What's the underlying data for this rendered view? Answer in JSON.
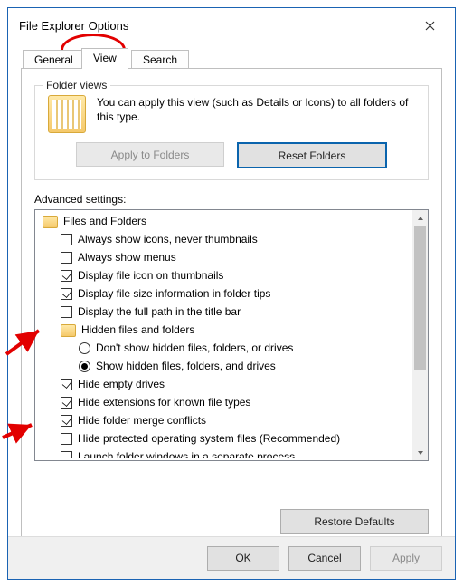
{
  "window": {
    "title": "File Explorer Options"
  },
  "tabs": {
    "general": "General",
    "view": "View",
    "search": "Search"
  },
  "folderViews": {
    "legend": "Folder views",
    "text": "You can apply this view (such as Details or Icons) to all folders of this type.",
    "applyBtn": "Apply to Folders",
    "resetBtn": "Reset Folders"
  },
  "advanced": {
    "label": "Advanced settings:",
    "root": "Files and Folders",
    "items": {
      "alwaysIcons": "Always show icons, never thumbnails",
      "alwaysMenus": "Always show menus",
      "fileIconThumb": "Display file icon on thumbnails",
      "fileSizeTips": "Display file size information in folder tips",
      "fullPathTitle": "Display the full path in the title bar",
      "hiddenGroup": "Hidden files and folders",
      "dontShowHidden": "Don't show hidden files, folders, or drives",
      "showHidden": "Show hidden files, folders, and drives",
      "hideEmpty": "Hide empty drives",
      "hideExt": "Hide extensions for known file types",
      "hideMerge": "Hide folder merge conflicts",
      "hideProtected": "Hide protected operating system files (Recommended)",
      "launchSeparate": "Launch folder windows in a separate process"
    },
    "restoreBtn": "Restore Defaults"
  },
  "buttons": {
    "ok": "OK",
    "cancel": "Cancel",
    "apply": "Apply"
  }
}
